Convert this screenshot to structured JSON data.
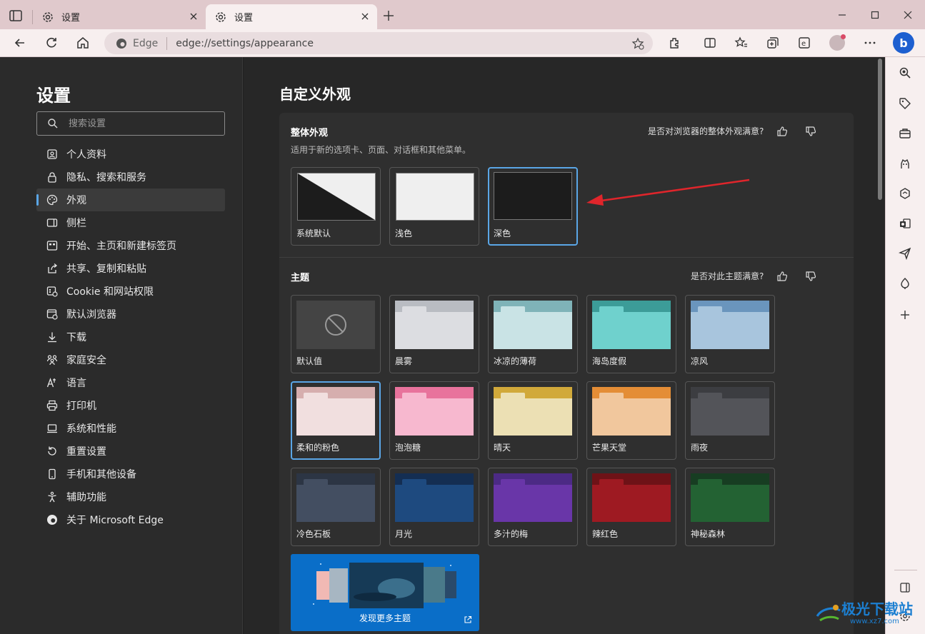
{
  "tabs": [
    {
      "title": "设置"
    },
    {
      "title": "设置"
    }
  ],
  "address_bar": {
    "brand": "Edge",
    "url": "edge://settings/appearance"
  },
  "copilot_label": "b",
  "nav": {
    "title": "设置",
    "search_placeholder": "搜索设置",
    "items": [
      {
        "label": "个人资料",
        "icon": "profile-icon"
      },
      {
        "label": "隐私、搜索和服务",
        "icon": "lock-icon"
      },
      {
        "label": "外观",
        "icon": "palette-icon",
        "active": true
      },
      {
        "label": "侧栏",
        "icon": "sidebar-icon"
      },
      {
        "label": "开始、主页和新建标签页",
        "icon": "home-grid-icon"
      },
      {
        "label": "共享、复制和粘贴",
        "icon": "share-icon"
      },
      {
        "label": "Cookie 和网站权限",
        "icon": "cookie-icon"
      },
      {
        "label": "默认浏览器",
        "icon": "browser-icon"
      },
      {
        "label": "下载",
        "icon": "download-icon"
      },
      {
        "label": "家庭安全",
        "icon": "family-icon"
      },
      {
        "label": "语言",
        "icon": "language-icon"
      },
      {
        "label": "打印机",
        "icon": "printer-icon"
      },
      {
        "label": "系统和性能",
        "icon": "laptop-icon"
      },
      {
        "label": "重置设置",
        "icon": "reset-icon"
      },
      {
        "label": "手机和其他设备",
        "icon": "phone-icon"
      },
      {
        "label": "辅助功能",
        "icon": "accessibility-icon"
      },
      {
        "label": "关于 Microsoft Edge",
        "icon": "edge-icon"
      }
    ]
  },
  "main": {
    "title": "自定义外观",
    "overall": {
      "title": "整体外观",
      "subtitle": "适用于新的选项卡、页面、对话框和其他菜单。",
      "feedback": "是否对浏览器的整体外观满意?",
      "options": [
        {
          "label": "系统默认",
          "selected": false
        },
        {
          "label": "浅色",
          "selected": false
        },
        {
          "label": "深色",
          "selected": true
        }
      ]
    },
    "themes": {
      "title": "主题",
      "feedback": "是否对此主题满意?",
      "items": [
        {
          "label": "默认值",
          "top": "#444444",
          "body": "#444444",
          "tab": "#444444",
          "default": true
        },
        {
          "label": "晨雾",
          "top": "#b9bcc2",
          "body": "#dcdde1",
          "tab": "#dcdde1"
        },
        {
          "label": "冰凉的薄荷",
          "top": "#7fb3b8",
          "body": "#c9e3e5",
          "tab": "#c9e3e5"
        },
        {
          "label": "海岛度假",
          "top": "#3c9c98",
          "body": "#6fd1cd",
          "tab": "#6fd1cd"
        },
        {
          "label": "凉风",
          "top": "#6a95bd",
          "body": "#a8c5dd",
          "tab": "#a8c5dd"
        },
        {
          "label": "柔和的粉色",
          "top": "#d6aeae",
          "body": "#f1dfdf",
          "tab": "#f1dfdf",
          "selected": true
        },
        {
          "label": "泡泡糖",
          "top": "#e8739c",
          "body": "#f7b8cf",
          "tab": "#f7b8cf"
        },
        {
          "label": "晴天",
          "top": "#d1a93a",
          "body": "#ece0b4",
          "tab": "#ece0b4"
        },
        {
          "label": "芒果天堂",
          "top": "#e48d36",
          "body": "#f1c79d",
          "tab": "#f1c79d"
        },
        {
          "label": "雨夜",
          "top": "#3c3d41",
          "body": "#535459",
          "tab": "#535459"
        },
        {
          "label": "冷色石板",
          "top": "#2c3544",
          "body": "#434e61",
          "tab": "#434e61"
        },
        {
          "label": "月光",
          "top": "#142e52",
          "body": "#1e4a7f",
          "tab": "#1e4a7f"
        },
        {
          "label": "多汁的梅",
          "top": "#4c2a85",
          "body": "#6936a8",
          "tab": "#6936a8"
        },
        {
          "label": "辣红色",
          "top": "#6e1217",
          "body": "#9e1a22",
          "tab": "#9e1a22"
        },
        {
          "label": "神秘森林",
          "top": "#173d22",
          "body": "#236233",
          "tab": "#236233"
        }
      ],
      "discover_label": "发现更多主题"
    }
  },
  "watermark": {
    "text": "极光下载站",
    "url": "www.xz7.com"
  },
  "colors": {
    "accent": "#5aa6e6",
    "arrow": "#e0252b",
    "discover_bg": "#0a6ec8"
  }
}
